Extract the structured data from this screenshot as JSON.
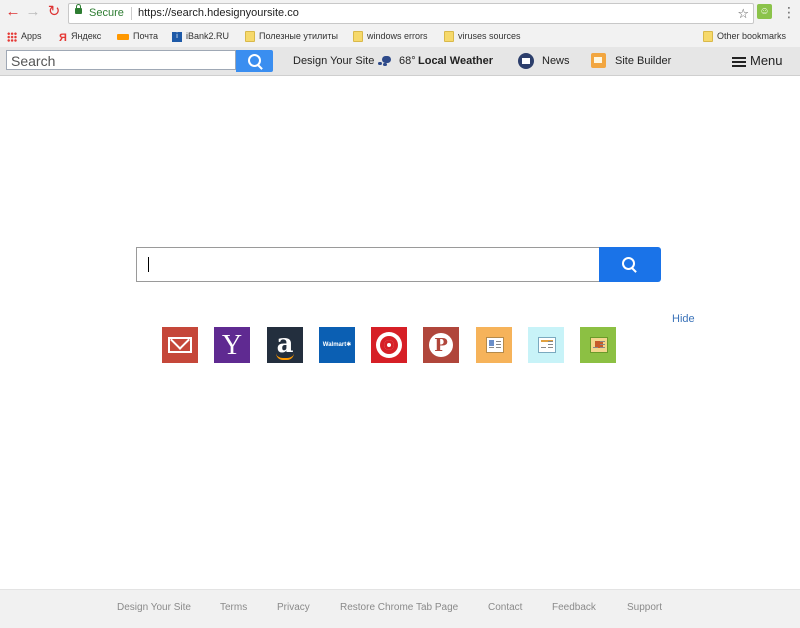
{
  "browser": {
    "secure_label": "Secure",
    "url": "https://search.hdesignyoursite.co",
    "bookmarks": [
      {
        "label": "Apps",
        "icon": "apps-grid-icon"
      },
      {
        "label": "Яндекс",
        "icon": "yandex-icon"
      },
      {
        "label": "Почта",
        "icon": "mail-ru-icon"
      },
      {
        "label": "iBank2.RU",
        "icon": "ibank-icon"
      },
      {
        "label": "Полезные утилиты",
        "icon": "folder-icon"
      },
      {
        "label": "windows errors",
        "icon": "folder-icon"
      },
      {
        "label": "viruses sources",
        "icon": "folder-icon"
      }
    ],
    "other_bookmarks": "Other bookmarks"
  },
  "toolbar": {
    "search_placeholder": "Search",
    "design_link": "Design Your Site",
    "weather_temp": "68°",
    "weather_label": "Local Weather",
    "news_label": "News",
    "site_builder_label": "Site Builder",
    "menu_label": "Menu"
  },
  "main": {
    "hide_label": "Hide",
    "tiles": [
      {
        "name": "gmail",
        "color": "#c5473a"
      },
      {
        "name": "yahoo",
        "text": "Y",
        "color": "#5f2a91"
      },
      {
        "name": "amazon",
        "text": "a",
        "color": "#232f3e"
      },
      {
        "name": "walmart",
        "text": "Walmart✱",
        "color": "#0b5fb3"
      },
      {
        "name": "target",
        "color": "#d61f26"
      },
      {
        "name": "pinterest",
        "text": "P",
        "color": "#b0463b"
      },
      {
        "name": "news-tile",
        "color": "#f6b35a"
      },
      {
        "name": "web-tile",
        "color": "#c8f3f8"
      },
      {
        "name": "builder-tile",
        "color": "#8cc043"
      }
    ]
  },
  "footer": {
    "links": [
      "Design Your Site",
      "Terms",
      "Privacy",
      "Restore Chrome Tab Page",
      "Contact",
      "Feedback",
      "Support"
    ]
  }
}
